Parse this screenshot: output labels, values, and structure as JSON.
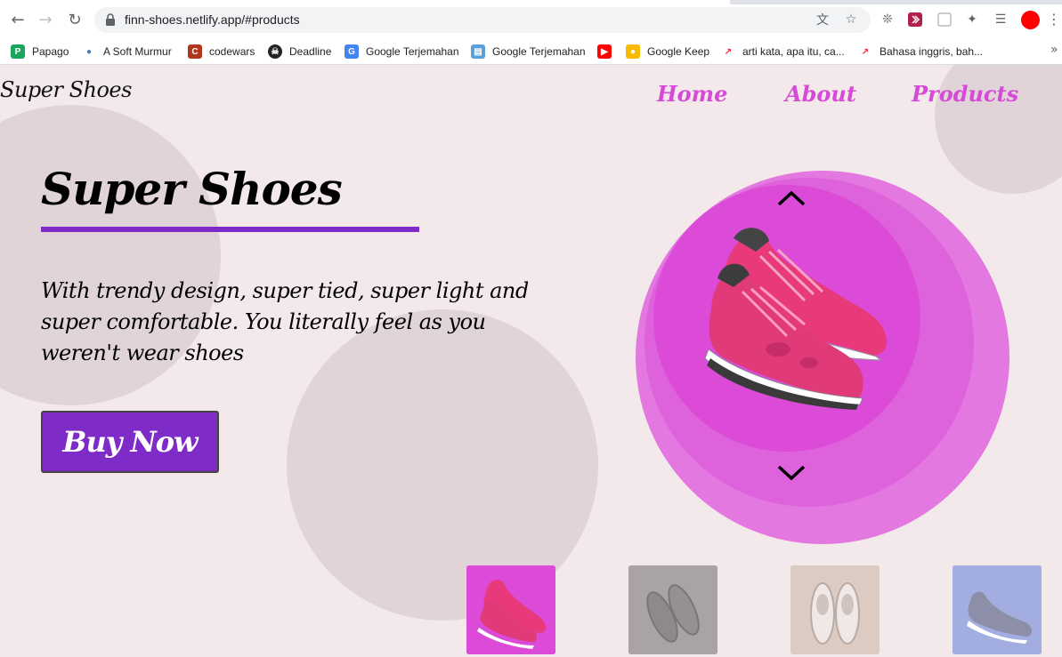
{
  "browser": {
    "url": "finn-shoes.netlify.app/#products",
    "bookmarks": [
      {
        "label": "Papago"
      },
      {
        "label": "A Soft Murmur"
      },
      {
        "label": "codewars"
      },
      {
        "label": "Deadline"
      },
      {
        "label": "Google Terjemahan"
      },
      {
        "label": "Google Terjemahan"
      },
      {
        "label": ""
      },
      {
        "label": "Google Keep"
      },
      {
        "label": "arti kata, apa itu, ca..."
      },
      {
        "label": "Bahasa inggris, bah..."
      }
    ]
  },
  "site": {
    "logo": "Super Shoes",
    "nav": {
      "home": "Home",
      "about": "About",
      "products": "Products"
    },
    "hero": {
      "title": "Super Shoes",
      "description": "With trendy design, super tied, super light and super comfortable. You literally feel as you weren't wear shoes",
      "buy_label": "Buy Now"
    },
    "colors": {
      "accent": "#7e2bc7",
      "nav": "#d64ad8",
      "circle": "#dc4ad8",
      "background": "#f4e9ea"
    },
    "thumbnails": [
      {
        "name": "pink-shoe",
        "bg": "#dc4ad8"
      },
      {
        "name": "gray-shoe",
        "bg": "#a9a3a5"
      },
      {
        "name": "white-shoe",
        "bg": "#dccbc3"
      },
      {
        "name": "blue-shoe",
        "bg": "#a3aee0"
      }
    ]
  }
}
